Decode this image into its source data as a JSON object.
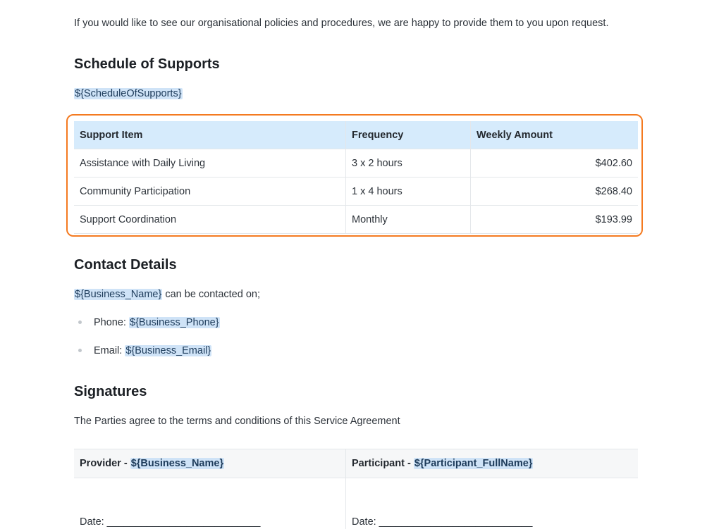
{
  "intro_text": "If you would like to see our organisational policies and procedures, we are happy to provide them to you upon request.",
  "schedule": {
    "heading": "Schedule of Supports",
    "placeholder": "${ScheduleOfSupports}",
    "columns": [
      "Support Item",
      "Frequency",
      "Weekly Amount"
    ],
    "rows": [
      {
        "item": "Assistance with Daily Living",
        "frequency": "3 x 2 hours",
        "amount": "$402.60"
      },
      {
        "item": "Community Participation",
        "frequency": "1 x 4 hours",
        "amount": "$268.40"
      },
      {
        "item": "Support Coordination",
        "frequency": "Monthly",
        "amount": "$193.99"
      }
    ],
    "highlight_color": "#f47a20",
    "header_color": "#d6ebfc"
  },
  "contact": {
    "heading": "Contact Details",
    "business_name_var": "${Business_Name}",
    "contact_suffix": " can be contacted on;",
    "phone_label": "Phone: ",
    "phone_var": "${Business_Phone}",
    "email_label": "Email: ",
    "email_var": "${Business_Email}"
  },
  "signatures": {
    "heading": "Signatures",
    "text": "The Parties agree to the terms and conditions of this Service Agreement",
    "provider_label": "Provider - ",
    "provider_var": "${Business_Name}",
    "participant_label": "Participant - ",
    "participant_var": "${Participant_FullName}",
    "date_provider": "Date: ___________________________",
    "date_participant": "Date: ___________________________"
  }
}
